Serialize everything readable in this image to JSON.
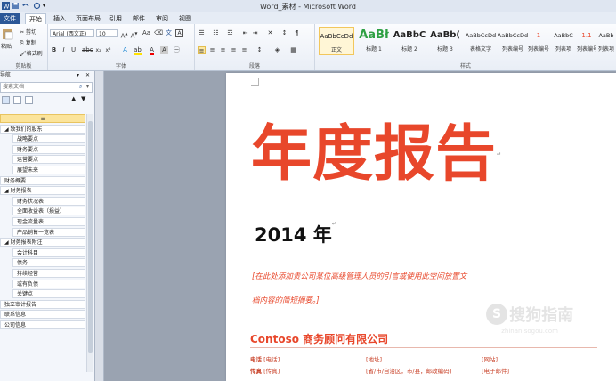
{
  "window": {
    "title": "Word_素材 - Microsoft Word"
  },
  "tabs": [
    "文件",
    "开始",
    "插入",
    "页面布局",
    "引用",
    "邮件",
    "审阅",
    "视图"
  ],
  "clipboard": {
    "paste": "粘贴",
    "cut": "剪切",
    "copy": "复制",
    "format_painter": "格式刷",
    "label": "剪贴板"
  },
  "font": {
    "name": "Arial (西文正)",
    "size": "10",
    "label": "字体"
  },
  "paragraph": {
    "label": "段落"
  },
  "styles": {
    "label": "样式",
    "items": [
      {
        "preview": "AaBbCcDd",
        "name": "正文"
      },
      {
        "preview": "AaBł",
        "name": "标题 1"
      },
      {
        "preview": "AaBbC",
        "name": "标题 2"
      },
      {
        "preview": "AaBb(",
        "name": "标题 3"
      },
      {
        "preview": "AaBbCcDd",
        "name": "表格文字"
      },
      {
        "preview": "AaBbCcDd",
        "name": "列表编号"
      },
      {
        "preview": "1",
        "name": "列表编号"
      },
      {
        "preview": "AaBbC",
        "name": "列表项"
      },
      {
        "preview": "1.1",
        "name": "列表编号"
      },
      {
        "preview": "AaBb",
        "name": "列表项"
      }
    ]
  },
  "nav": {
    "header": "导航",
    "search_placeholder": "搜索文档",
    "items": [
      {
        "label": "≡",
        "level": 0
      },
      {
        "label": "◢ 致我们的股东",
        "level": 0
      },
      {
        "label": "战略要点",
        "level": 1
      },
      {
        "label": "财务要点",
        "level": 1
      },
      {
        "label": "运营要点",
        "level": 1
      },
      {
        "label": "展望未来",
        "level": 1
      },
      {
        "label": "财务概要",
        "level": 0
      },
      {
        "label": "◢ 财务报表",
        "level": 0
      },
      {
        "label": "财务状况表",
        "level": 1
      },
      {
        "label": "全面收益表（损益）",
        "level": 1
      },
      {
        "label": "现金流量表",
        "level": 1
      },
      {
        "label": "产品销售一览表",
        "level": 1
      },
      {
        "label": "◢ 财务报表附注",
        "level": 0
      },
      {
        "label": "会计科目",
        "level": 1
      },
      {
        "label": "债务",
        "level": 1
      },
      {
        "label": "持续经营",
        "level": 1
      },
      {
        "label": "或有负债",
        "level": 1
      },
      {
        "label": "关键点",
        "level": 1
      },
      {
        "label": "独立审计报告",
        "level": 0
      },
      {
        "label": "联系信息",
        "level": 0
      },
      {
        "label": "公司信息",
        "level": 0
      }
    ]
  },
  "doc": {
    "title": "年度报告",
    "year": "2014 年",
    "placeholder_line1": "[在此处添加贵公司某位高级管理人员的引言或使用此空间放置文",
    "placeholder_line2": "档内容的简短摘要。]",
    "company": "Contoso 商务顾问有限公司",
    "contact": {
      "phone_label": "电话",
      "phone_value": "[电话]",
      "fax_label": "传真",
      "fax_value": "[传真]",
      "address": "[地址]",
      "city": "[省/市/自治区，市/县，邮政编码]",
      "web": "[网站]",
      "email": "[电子邮件]"
    },
    "watermark": "搜狗指南",
    "watermark_url": "zhinan.sogou.com"
  },
  "colors": {
    "accent": "#e8472b",
    "file_tab": "#2b5797"
  }
}
